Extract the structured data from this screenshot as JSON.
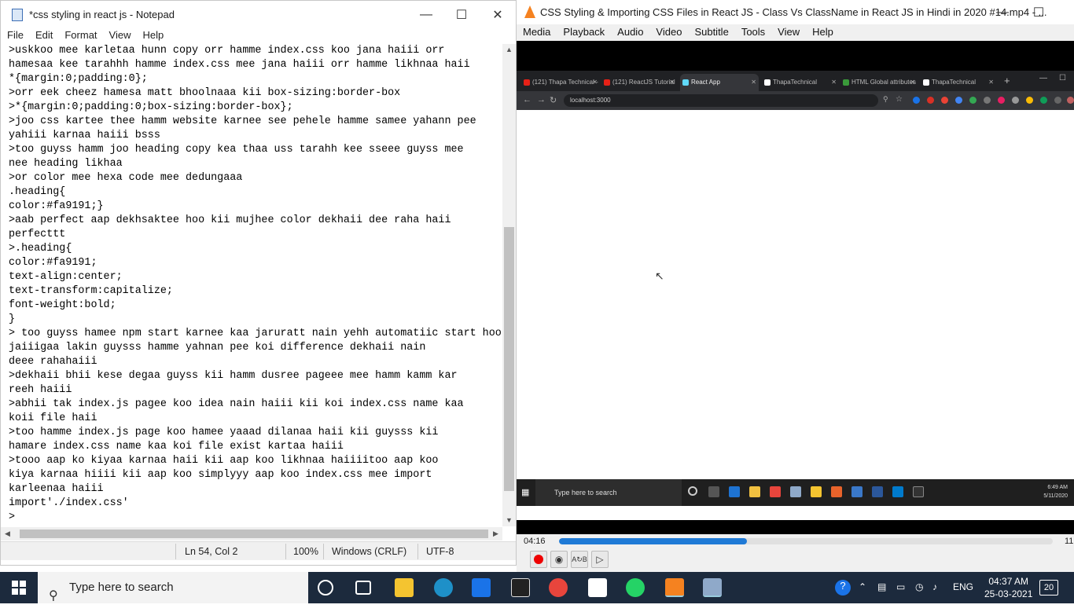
{
  "notepad": {
    "title": "*css styling in react js - Notepad",
    "menu": [
      "File",
      "Edit",
      "Format",
      "View",
      "Help"
    ],
    "lines": [
      ">uskkoo mee karletaa hunn copy orr hamme index.css koo jana haiii orr",
      "hamesaa kee tarahhh hamme index.css mee jana haiii orr hamme likhnaa haii",
      "*{margin:0;padding:0};",
      ">orr eek cheez hamesa matt bhoolnaaa kii box-sizing:border-box",
      ">*{margin:0;padding:0;box-sizing:border-box};",
      ">joo css kartee thee hamm website karnee see pehele hamme samee yahann pee",
      "yahiii karnaa haiii bsss",
      ">too guyss hamm joo heading copy kea thaa uss tarahh kee sseee guyss mee",
      "nee heading likhaa",
      ">or color mee hexa code mee dedungaaa",
      ".heading{",
      "color:#fa9191;}",
      ">aab perfect aap dekhsaktee hoo kii mujhee color dekhaii dee raha haii",
      "perfecttt",
      ">.heading{",
      "color:#fa9191;",
      "text-align:center;",
      "text-transform:capitalize;",
      "font-weight:bold;",
      "}",
      "> too guyss hamee npm start karnee kaa jaruratt nain yehh automatiic start hoo",
      "jaiiigaa lakin guysss hamme yahnan pee koi difference dekhaii nain",
      "deee rahahaiii",
      ">dekhaii bhii kese degaa guyss kii hamm dusree pageee mee hamm kamm kar",
      "reeh haiii",
      ">abhii tak index.js pagee koo idea nain haiii kii koi index.css name kaa",
      "koii file haii",
      ">too hamme index.js page koo hamee yaaad dilanaa haii kii guysss kii",
      "hamare index.css name kaa koi file exist kartaa haiii",
      ">tooo aap ko kiyaa karnaa haii kii aap koo likhnaa haiiiitoo aap koo",
      "kiya karnaa hiiii kii aap koo simplyyy aap koo index.css mee import",
      "karleenaa haiii",
      "import'./index.css'",
      ">"
    ],
    "status": {
      "position": "Ln 54, Col 2",
      "zoom": "100%",
      "line_ending": "Windows (CRLF)",
      "encoding": "UTF-8"
    }
  },
  "vlc": {
    "title": "CSS Styling & Importing CSS Files in React JS - Class Vs ClassName in React JS in Hindi in 2020 #14.mp4 - ...",
    "menu": [
      "Media",
      "Playback",
      "Audio",
      "Video",
      "Subtitle",
      "Tools",
      "View",
      "Help"
    ],
    "elapsed": "04:16",
    "total_partial": "11",
    "progress_fraction": 0.38
  },
  "browser": {
    "tabs": [
      {
        "label": "(121) Thapa Technical -",
        "active": false,
        "color": "#e62117"
      },
      {
        "label": "(121) ReactJS Tutorial in",
        "active": false,
        "color": "#e62117"
      },
      {
        "label": "React App",
        "active": true,
        "color": "#61dafb"
      },
      {
        "label": "ThapaTechnical",
        "active": false,
        "color": "#ffffff"
      },
      {
        "label": "HTML Global attributes",
        "active": false,
        "color": "#3a9a3a"
      },
      {
        "label": "ThapaTechnical",
        "active": false,
        "color": "#ffffff"
      }
    ],
    "url": "localhost:3000"
  },
  "inner_taskbar": {
    "search_placeholder": "Type here to search",
    "time": "6:49 AM",
    "date": "5/11/2020"
  },
  "taskbar": {
    "search_placeholder": "Type here to search",
    "language": "ENG",
    "time": "04:37 AM",
    "date": "25-03-2021",
    "notifications": "20"
  },
  "colors": {
    "seek_fill": "#1f7ad6",
    "vlc_orange": "#f58220",
    "taskbar_bg": "#1c2a3d"
  }
}
